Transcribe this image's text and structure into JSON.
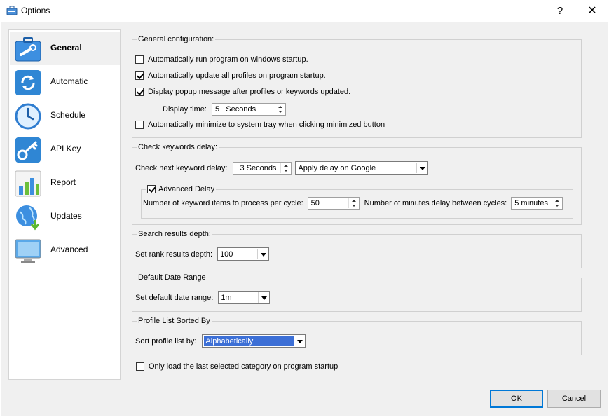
{
  "window": {
    "title": "Options",
    "help_glyph": "?",
    "close_glyph": "✕"
  },
  "sidebar": {
    "items": [
      {
        "label": "General",
        "icon": "wrench-briefcase-icon"
      },
      {
        "label": "Automatic",
        "icon": "refresh-arrows-icon"
      },
      {
        "label": "Schedule",
        "icon": "clock-icon"
      },
      {
        "label": "API Key",
        "icon": "key-icon"
      },
      {
        "label": "Report",
        "icon": "bar-chart-icon"
      },
      {
        "label": "Updates",
        "icon": "globe-download-icon"
      },
      {
        "label": "Advanced",
        "icon": "monitor-icon"
      }
    ]
  },
  "general": {
    "legend": "General configuration:",
    "startup_run": "Automatically run program on windows startup.",
    "auto_update": "Automatically update all profiles on program startup.",
    "popup": "Display popup message after profiles or keywords updated.",
    "display_time_label": "Display time:",
    "display_time_value": "5   Seconds",
    "minimize_tray": "Automatically minimize to system tray when clicking minimized button"
  },
  "delay": {
    "legend": "Check keywords delay:",
    "next_label": "Check next keyword delay:",
    "next_value": "3 Seconds",
    "apply_value": "Apply delay on Google",
    "advanced_legend": "Advanced Delay",
    "items_label": "Number of keyword items to process per cycle:",
    "items_value": "50",
    "minutes_label": "Number of minutes delay between cycles:",
    "minutes_value": "5 minutes"
  },
  "depth": {
    "legend": "Search results depth:",
    "label": "Set rank results depth:",
    "value": "100"
  },
  "daterange": {
    "legend": "Default Date Range",
    "label": "Set default date range:",
    "value": "1m"
  },
  "sorted": {
    "legend": "Profile List Sorted By",
    "label": "Sort profile list by:",
    "value": "Alphabetically"
  },
  "last_category": "Only load the last selected category on program startup",
  "buttons": {
    "ok": "OK",
    "cancel": "Cancel"
  },
  "colors": {
    "selection": "#3c6fd6",
    "default_button_border": "#0078d7"
  }
}
